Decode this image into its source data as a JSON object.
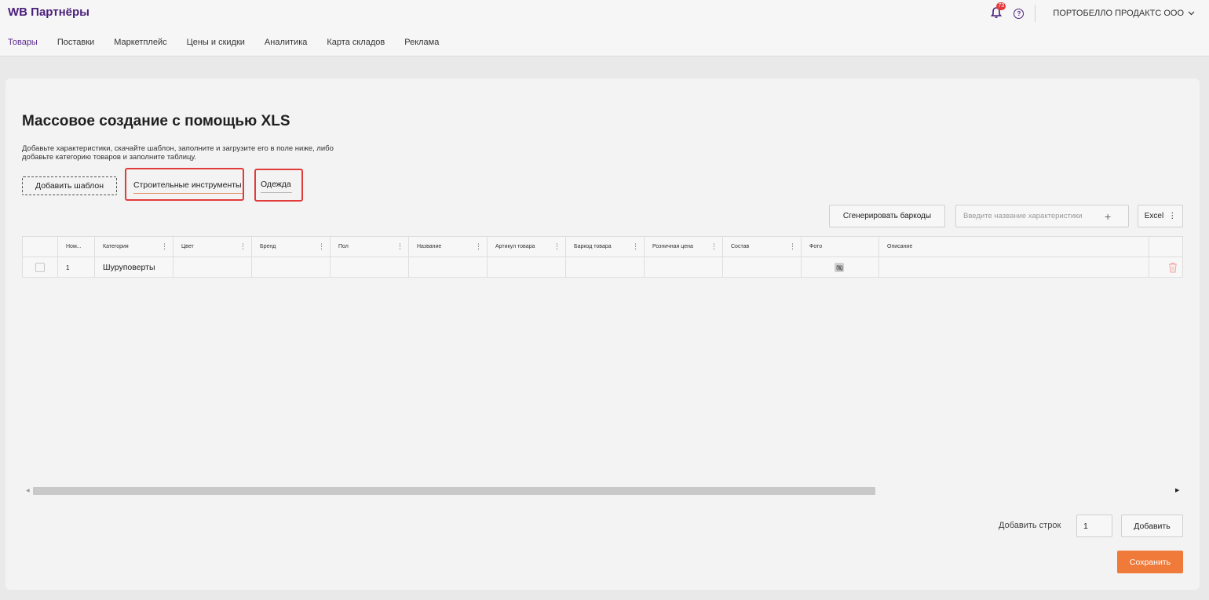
{
  "header": {
    "logo": "WB Партнёры",
    "notifications_count": "73",
    "help_symbol": "?",
    "company": "ПОРТОБЕЛЛО ПРОДАКТС ООО",
    "nav": [
      {
        "label": "Товары"
      },
      {
        "label": "Поставки"
      },
      {
        "label": "Маркетплейс"
      },
      {
        "label": "Цены и скидки"
      },
      {
        "label": "Аналитика"
      },
      {
        "label": "Карта складов"
      },
      {
        "label": "Реклама"
      }
    ],
    "active_nav": "Товары"
  },
  "page": {
    "title": "Массовое создание с помощью XLS",
    "description": "Добавьте характеристики, скачайте шаблон, заполните и загрузите его в поле ниже, либо добавьте категорию товаров и заполните таблицу.",
    "add_template_label": "Добавить шаблон",
    "category_tabs": [
      "Строительные инструменты",
      "Одежда"
    ]
  },
  "toolbar": {
    "generate_barcodes_label": "Сгенерировать баркоды",
    "characteristic_placeholder": "Введите название характеристики",
    "plus_symbol": "+",
    "excel_label": "Excel",
    "kebab_symbol": "⋮"
  },
  "table": {
    "columns": [
      "Ном...",
      "Категория",
      "Цвет",
      "Бренд",
      "Пол",
      "Название",
      "Артикул товара",
      "Баркод товара",
      "Розничная цена",
      "Состав",
      "Фото",
      "Описание"
    ],
    "rows": [
      {
        "num": "1",
        "category": "Шуруповерты"
      }
    ]
  },
  "footer": {
    "add_rows_label": "Добавить строк",
    "rows_value": "1",
    "add_label": "Добавить",
    "save_label": "Сохранить"
  },
  "colors": {
    "brand": "#4b1f7c",
    "accent": "#f07a3a",
    "highlight": "#e23b3b"
  }
}
